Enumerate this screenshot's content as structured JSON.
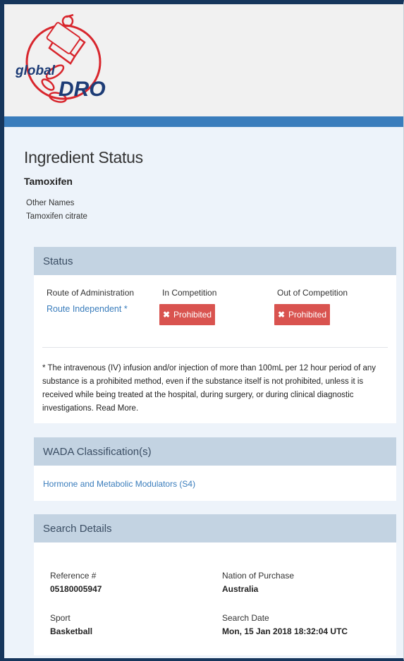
{
  "logo": {
    "text_global": "global",
    "text_dro": "DRO",
    "brand_color": "#d8262d"
  },
  "page": {
    "title": "Ingredient Status",
    "ingredient": "Tamoxifen",
    "other_names_label": "Other Names",
    "other_names_value": "Tamoxifen citrate"
  },
  "status": {
    "heading": "Status",
    "route_header": "Route of Administration",
    "in_comp_header": "In Competition",
    "out_comp_header": "Out of Competition",
    "route_value": "Route Independent  *",
    "in_comp_value": "Prohibited",
    "out_comp_value": "Prohibited",
    "prohibited_icon": "x-icon",
    "prohibited_color": "#d9534f",
    "note": "* The intravenous (IV) infusion and/or injection of more than 100mL per 12 hour period of any substance is a prohibited method, even if the substance itself is not prohibited, unless it is received while being treated at the hospital, during surgery, or during clinical diagnostic investigations. Read More."
  },
  "wada": {
    "heading": "WADA Classification(s)",
    "item": "Hormone and Metabolic Modulators (S4)"
  },
  "search": {
    "heading": "Search Details",
    "ref_label": "Reference #",
    "ref_value": "05180005947",
    "nation_label": "Nation of Purchase",
    "nation_value": "Australia",
    "sport_label": "Sport",
    "sport_value": "Basketball",
    "date_label": "Search Date",
    "date_value": "Mon, 15 Jan 2018 18:32:04 UTC"
  },
  "colors": {
    "frame": "#16365c",
    "accent_bar": "#3a7dbc",
    "link": "#3a7dbc",
    "panel_header": "#c3d3e2"
  }
}
